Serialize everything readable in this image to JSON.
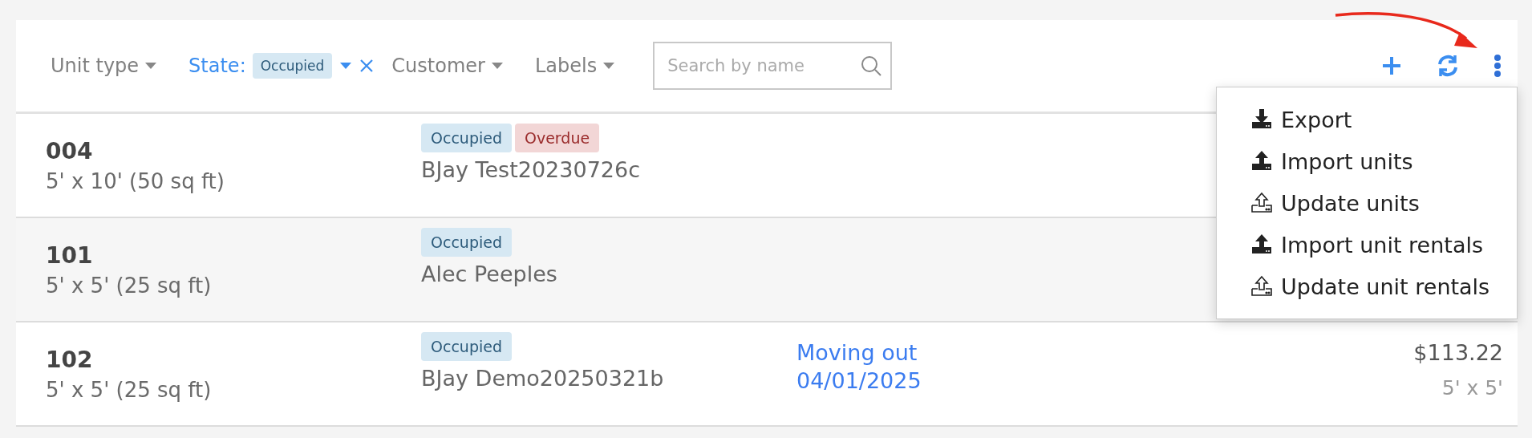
{
  "toolbar": {
    "filters": [
      {
        "kind": "dropdown",
        "label": "Unit type"
      },
      {
        "kind": "active",
        "label": "State:",
        "value": "Occupied"
      },
      {
        "kind": "dropdown",
        "label": "Customer"
      },
      {
        "kind": "dropdown",
        "label": "Labels"
      }
    ],
    "search": {
      "placeholder": "Search by name"
    }
  },
  "menu": {
    "items": [
      {
        "kind": "download",
        "label": "Export"
      },
      {
        "kind": "upload-solid",
        "label": "Import units"
      },
      {
        "kind": "upload-outline",
        "label": "Update units"
      },
      {
        "kind": "upload-solid",
        "label": "Import unit rentals"
      },
      {
        "kind": "upload-outline",
        "label": "Update unit rentals"
      }
    ]
  },
  "rows": [
    {
      "unit": "004",
      "size": "5' x 10' (50 sq ft)",
      "tags": [
        {
          "kind": "occupied",
          "label": "Occupied"
        },
        {
          "kind": "overdue",
          "label": "Overdue"
        }
      ],
      "customer": "BJay Test20230726c"
    },
    {
      "unit": "101",
      "size": "5' x 5' (25 sq ft)",
      "tags": [
        {
          "kind": "occupied",
          "label": "Occupied"
        }
      ],
      "customer": "Alec Peeples"
    },
    {
      "unit": "102",
      "size": "5' x 5' (25 sq ft)",
      "tags": [
        {
          "kind": "occupied",
          "label": "Occupied"
        }
      ],
      "customer": "BJay Demo20250321b",
      "move_out": [
        "Moving out",
        "04/01/2025"
      ],
      "price": "$113.22",
      "dimensions": "5' x 5'"
    }
  ]
}
